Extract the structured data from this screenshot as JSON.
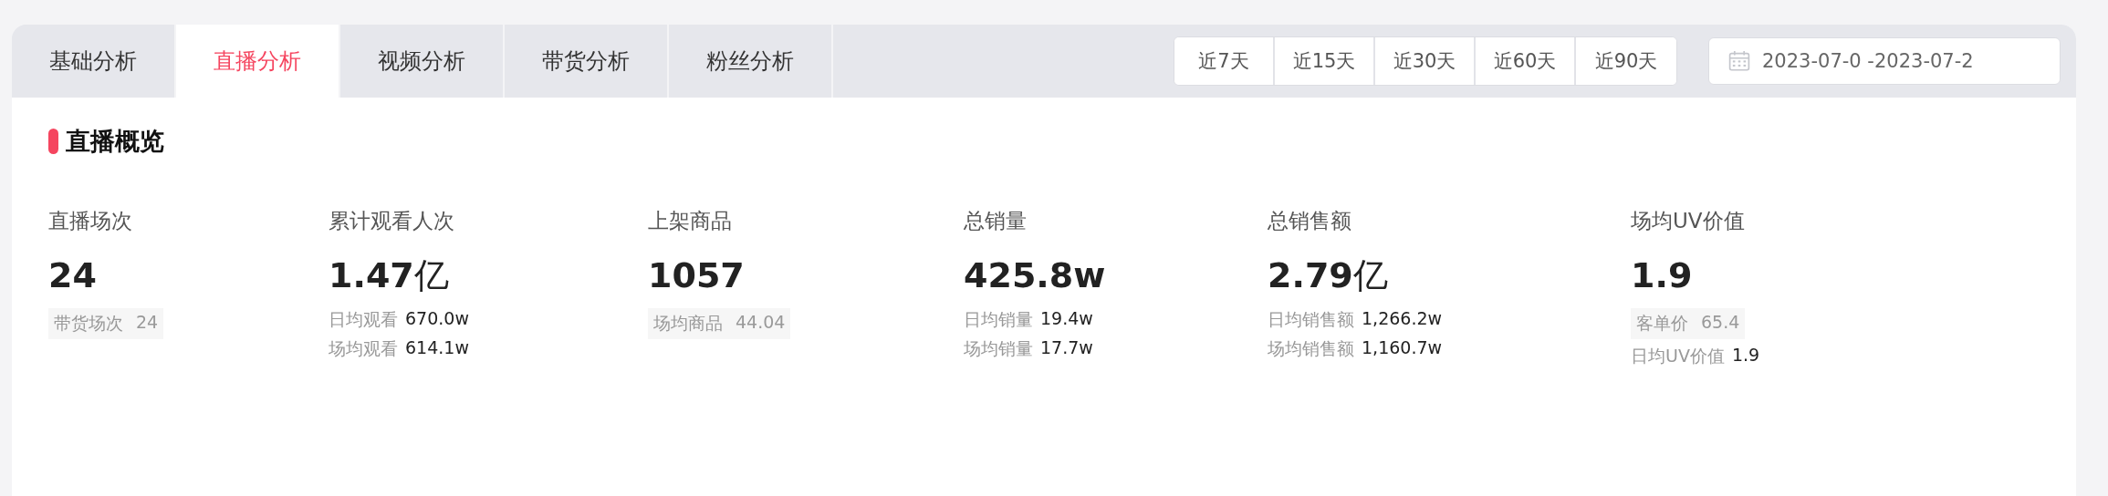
{
  "tabs": [
    {
      "label": "基础分析",
      "selected": false
    },
    {
      "label": "直播分析",
      "selected": true
    },
    {
      "label": "视频分析",
      "selected": false
    },
    {
      "label": "带货分析",
      "selected": false
    },
    {
      "label": "粉丝分析",
      "selected": false
    }
  ],
  "ranges": [
    {
      "label": "近7天",
      "selected": false
    },
    {
      "label": "近15天",
      "selected": false
    },
    {
      "label": "近30天",
      "selected": false
    },
    {
      "label": "近60天",
      "selected": false
    },
    {
      "label": "近90天",
      "selected": false
    }
  ],
  "date_range": {
    "value": "2023-07-0 -2023-07-2"
  },
  "section": {
    "title": "直播概览"
  },
  "stats": [
    {
      "label": "直播场次",
      "value": "24",
      "details": [
        {
          "kind": "tag",
          "label": "带货场次",
          "value": "24"
        }
      ]
    },
    {
      "label": "累计观看人次",
      "value": "1.47",
      "unit": "亿",
      "details": [
        {
          "kind": "plain",
          "label": "日均观看",
          "value": "670.0w"
        },
        {
          "kind": "plain",
          "label": "场均观看",
          "value": "614.1w"
        }
      ]
    },
    {
      "label": "上架商品",
      "value": "1057",
      "details": [
        {
          "kind": "tag",
          "label": "场均商品",
          "value": "44.04"
        }
      ]
    },
    {
      "label": "总销量",
      "value": "425.8w",
      "details": [
        {
          "kind": "plain",
          "label": "日均销量",
          "value": "19.4w"
        },
        {
          "kind": "plain",
          "label": "场均销量",
          "value": "17.7w"
        }
      ]
    },
    {
      "label": "总销售额",
      "value": "2.79",
      "unit": "亿",
      "details": [
        {
          "kind": "plain",
          "label": "日均销售额",
          "value": "1,266.2w"
        },
        {
          "kind": "plain",
          "label": "场均销售额",
          "value": "1,160.7w"
        }
      ]
    },
    {
      "label": "场均UV价值",
      "value": "1.9",
      "details": [
        {
          "kind": "tag",
          "label": "客单价",
          "value": "65.4"
        },
        {
          "kind": "plain",
          "label": "日均UV价值",
          "value": "1.9"
        }
      ]
    }
  ]
}
